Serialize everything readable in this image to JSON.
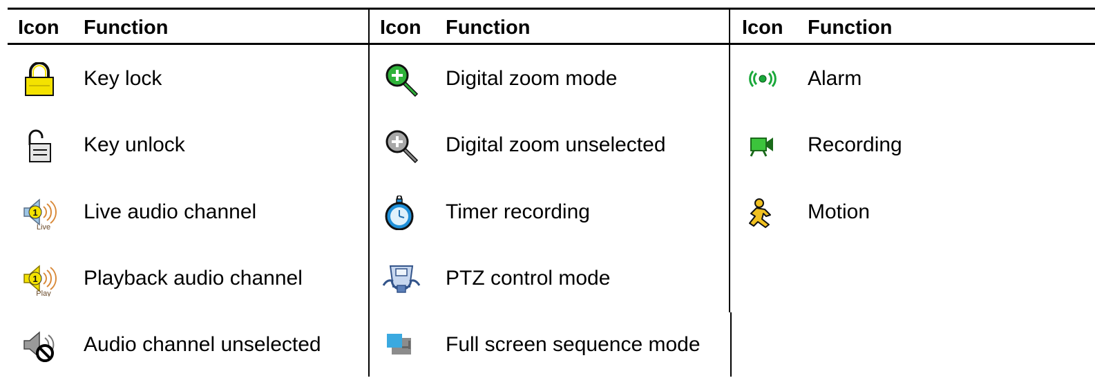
{
  "columns": [
    {
      "header_icon": "Icon",
      "header_function": "Function",
      "rows": [
        {
          "icon": "key-lock-icon",
          "label": "Key lock"
        },
        {
          "icon": "key-unlock-icon",
          "label": "Key unlock"
        },
        {
          "icon": "live-audio-channel-icon",
          "label": "Live audio channel"
        },
        {
          "icon": "playback-audio-channel-icon",
          "label": "Playback audio channel"
        },
        {
          "icon": "audio-unselected-icon",
          "label": "Audio channel unselected"
        }
      ]
    },
    {
      "header_icon": "Icon",
      "header_function": "Function",
      "rows": [
        {
          "icon": "digital-zoom-icon",
          "label": "Digital zoom mode"
        },
        {
          "icon": "digital-zoom-unselected-icon",
          "label": "Digital zoom unselected"
        },
        {
          "icon": "timer-recording-icon",
          "label": "Timer recording"
        },
        {
          "icon": "ptz-control-icon",
          "label": "PTZ control mode"
        },
        {
          "icon": "full-screen-sequence-icon",
          "label": "Full screen sequence mode"
        }
      ]
    },
    {
      "header_icon": "Icon",
      "header_function": "Function",
      "rows": [
        {
          "icon": "alarm-icon",
          "label": "Alarm"
        },
        {
          "icon": "recording-icon",
          "label": "Recording"
        },
        {
          "icon": "motion-icon",
          "label": "Motion"
        }
      ]
    }
  ],
  "colors": {
    "lock_yellow": "#f4e200",
    "zoom_green": "#2fb33a",
    "audio_orange": "#d98a3a",
    "timer_blue": "#1f8fd8",
    "sequence_blue": "#3aa9e0",
    "alarm_green": "#1aa83a",
    "recording_green": "#3cc43c",
    "motion_yellow": "#f0c020"
  },
  "icon_text": {
    "live_number": "1",
    "live_sub": "Live",
    "play_number": "1",
    "play_sub": "Play"
  }
}
